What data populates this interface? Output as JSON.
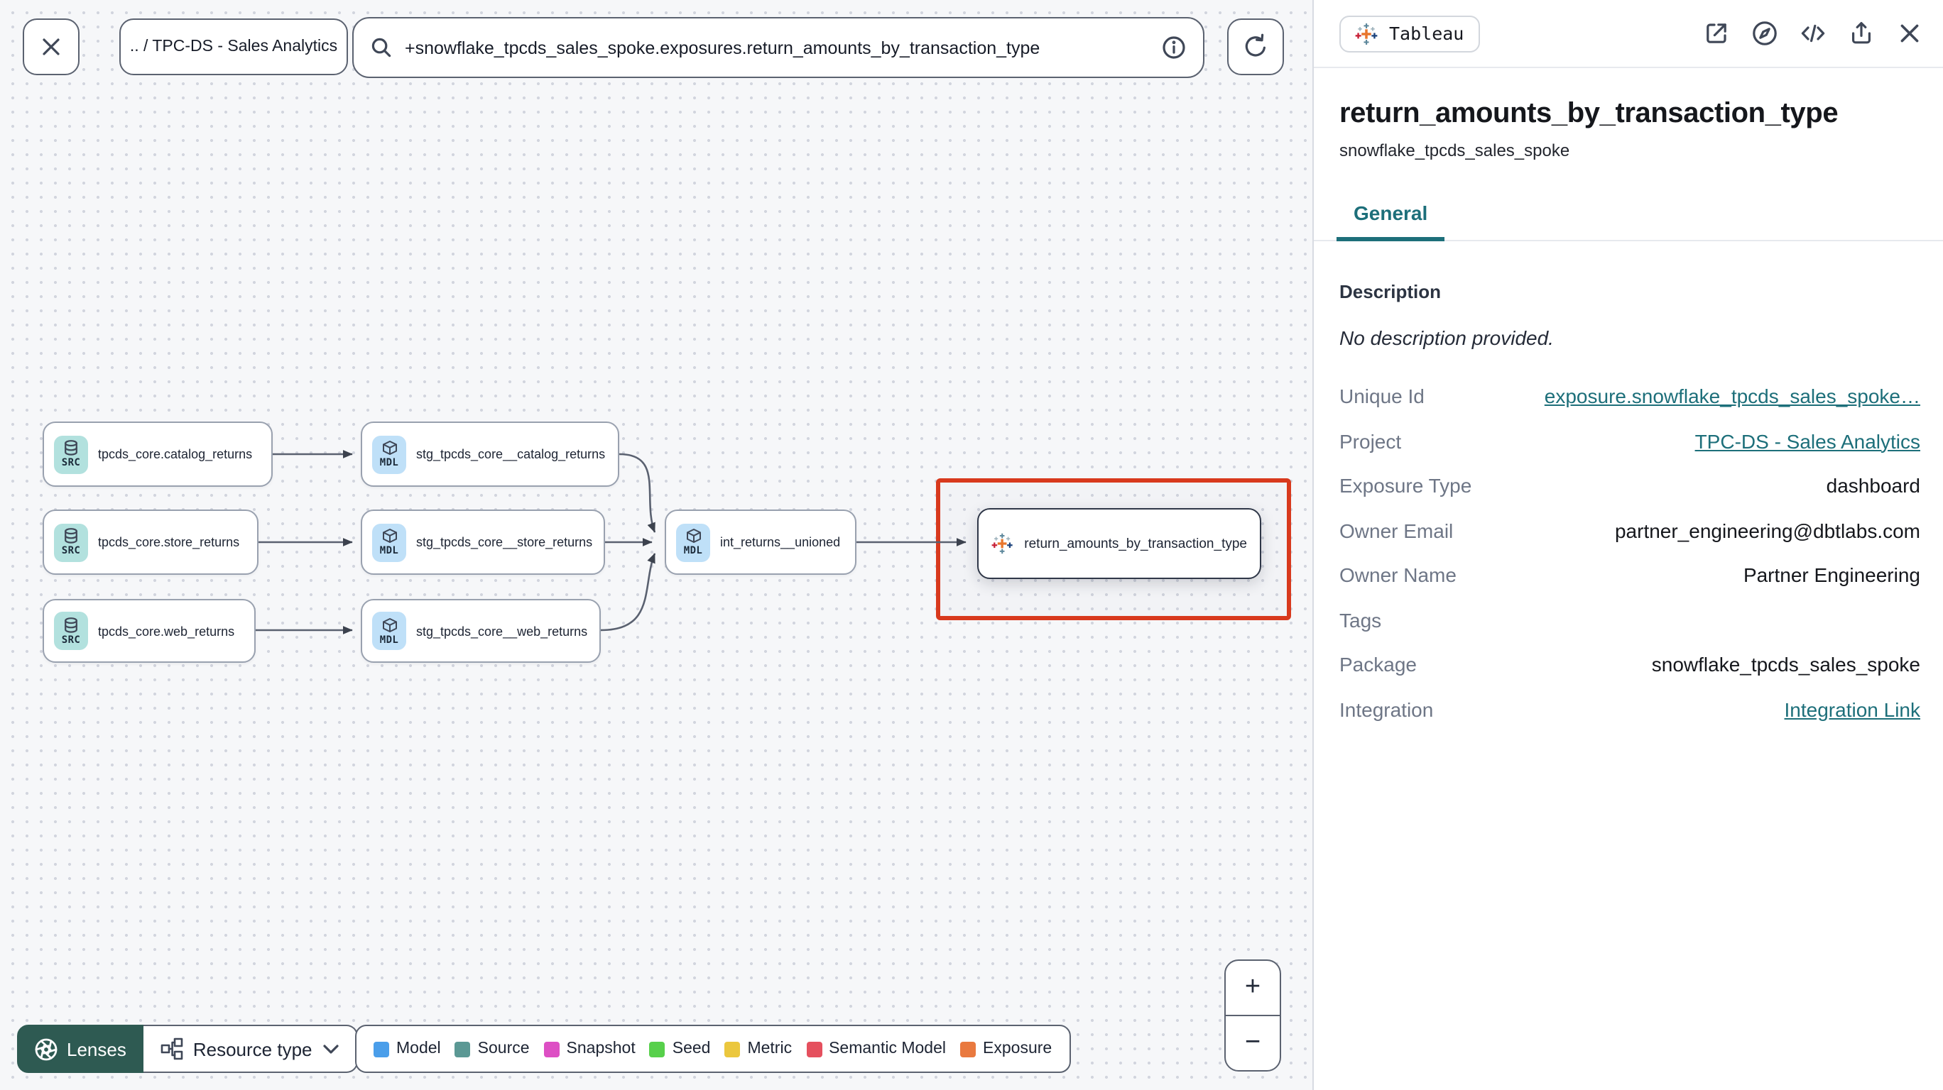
{
  "toolbar": {
    "breadcrumb": ".. / TPC-DS - Sales Analytics",
    "search_value": "+snowflake_tpcds_sales_spoke.exposures.return_amounts_by_transaction_type"
  },
  "graph": {
    "nodes": [
      {
        "label": "tpcds_core.catalog_returns",
        "badge": "SRC",
        "type": "source"
      },
      {
        "label": "tpcds_core.store_returns",
        "badge": "SRC",
        "type": "source"
      },
      {
        "label": "tpcds_core.web_returns",
        "badge": "SRC",
        "type": "source"
      },
      {
        "label": "stg_tpcds_core__catalog_returns",
        "badge": "MDL",
        "type": "model"
      },
      {
        "label": "stg_tpcds_core__store_returns",
        "badge": "MDL",
        "type": "model"
      },
      {
        "label": "stg_tpcds_core__web_returns",
        "badge": "MDL",
        "type": "model"
      },
      {
        "label": "int_returns__unioned",
        "badge": "MDL",
        "type": "model"
      },
      {
        "label": "return_amounts_by_transaction_type",
        "badge": "tableau",
        "type": "exposure"
      }
    ]
  },
  "legend": [
    {
      "label": "Model",
      "color": "#4a9eea"
    },
    {
      "label": "Source",
      "color": "#5b9894"
    },
    {
      "label": "Snapshot",
      "color": "#dd4fc4"
    },
    {
      "label": "Seed",
      "color": "#57d04b"
    },
    {
      "label": "Metric",
      "color": "#ebc73e"
    },
    {
      "label": "Semantic Model",
      "color": "#e5505e"
    },
    {
      "label": "Exposure",
      "color": "#e9793f"
    }
  ],
  "controls": {
    "lenses": "Lenses",
    "resource_type": "Resource type",
    "zoom_in": "+",
    "zoom_out": "−"
  },
  "panel": {
    "integration_badge": "Tableau",
    "title": "return_amounts_by_transaction_type",
    "subtitle": "snowflake_tpcds_sales_spoke",
    "tab": "General",
    "description_label": "Description",
    "description_value": "No description provided.",
    "fields": [
      {
        "label": "Unique Id",
        "value": "exposure.snowflake_tpcds_sales_spoke…",
        "link": true
      },
      {
        "label": "Project",
        "value": "TPC-DS - Sales Analytics",
        "link": true
      },
      {
        "label": "Exposure Type",
        "value": "dashboard",
        "link": false
      },
      {
        "label": "Owner Email",
        "value": "partner_engineering@dbtlabs.com",
        "link": false
      },
      {
        "label": "Owner Name",
        "value": "Partner Engineering",
        "link": false
      },
      {
        "label": "Tags",
        "value": "",
        "link": false
      },
      {
        "label": "Package",
        "value": "snowflake_tpcds_sales_spoke",
        "link": false
      },
      {
        "label": "Integration",
        "value": "Integration Link",
        "link": true
      }
    ]
  },
  "icons": {
    "toolbar": [
      "close-icon",
      "search-icon",
      "info-icon",
      "refresh-icon"
    ],
    "panel_header": [
      "tableau-logo-icon",
      "external-link-icon",
      "compass-icon",
      "code-icon",
      "share-icon",
      "close-icon"
    ],
    "graph": [
      "database-icon",
      "cube-icon",
      "tableau-logo-icon"
    ],
    "controls": [
      "aperture-icon",
      "hierarchy-icon",
      "chevron-down-icon",
      "plus-icon",
      "minus-icon"
    ]
  },
  "colors": {
    "accent_teal": "#1d6f7a",
    "highlight_red": "#d8391d",
    "lenses_green": "#2e5a52",
    "src_badge": "#b2e1de",
    "mdl_badge": "#bfe0f8"
  }
}
